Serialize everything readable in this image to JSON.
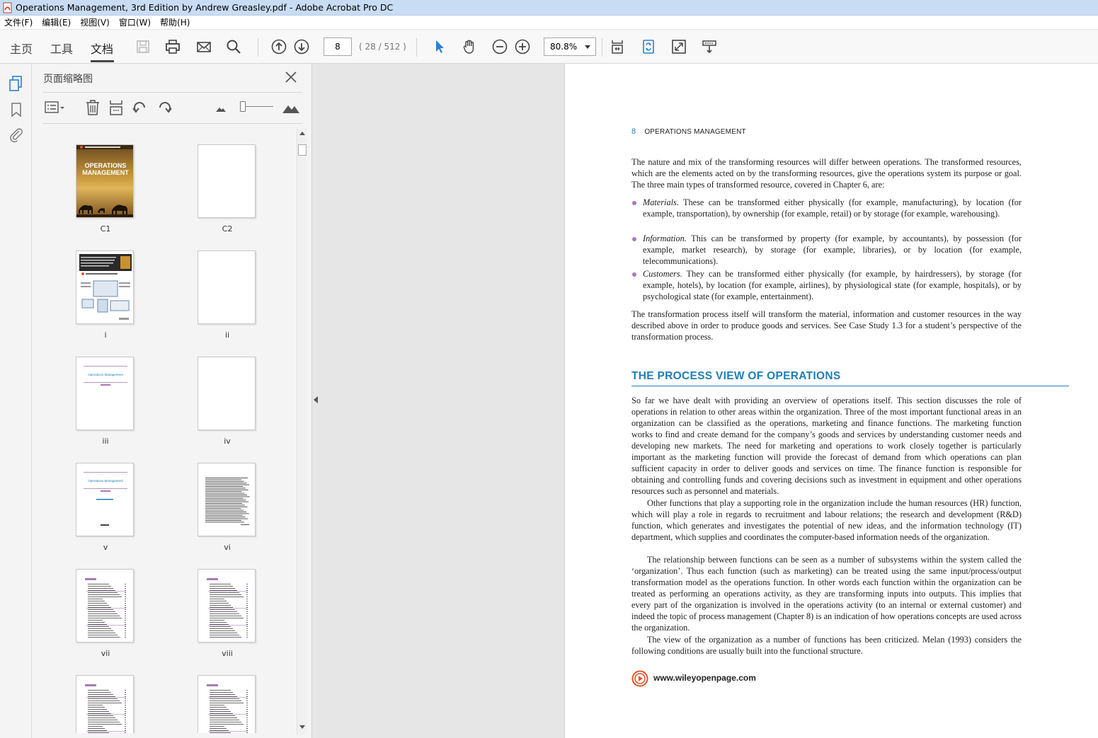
{
  "window": {
    "title": "Operations Management, 3rd Edition by Andrew Greasley.pdf - Adobe Acrobat Pro DC"
  },
  "menu": [
    "文件(F)",
    "编辑(E)",
    "视图(V)",
    "窗口(W)",
    "帮助(H)"
  ],
  "tabs": {
    "home": "主页",
    "tools": "工具",
    "document": "文档"
  },
  "toolbar": {
    "page_number": "8",
    "page_count": "( 28 / 512 )",
    "zoom": "80.8%"
  },
  "panel": {
    "title": "页面缩略图",
    "thumbnails": [
      {
        "label": "C1",
        "kind": "cover",
        "cover_title": "OPERATIONS MANAGEMENT"
      },
      {
        "label": "C2",
        "kind": "blank"
      },
      {
        "label": "i",
        "kind": "ebook"
      },
      {
        "label": "ii",
        "kind": "blank"
      },
      {
        "label": "iii",
        "kind": "halftitle",
        "small_title": "Operations Management"
      },
      {
        "label": "iv",
        "kind": "blank"
      },
      {
        "label": "v",
        "kind": "titlepage",
        "small_title": "Operations Management"
      },
      {
        "label": "vi",
        "kind": "text"
      },
      {
        "label": "vii",
        "kind": "toc"
      },
      {
        "label": "viii",
        "kind": "toc"
      },
      {
        "label": "",
        "kind": "toc"
      },
      {
        "label": "",
        "kind": "toc"
      }
    ]
  },
  "document": {
    "page_number": "8",
    "running_head": "OPERATIONS MANAGEMENT",
    "intro": "The nature and mix of the transforming resources will differ between operations. The transformed resources, which are the elements acted on by the transforming resources, give the operations system its purpose or goal. The three main types of transformed resource, covered in Chapter 6, are:",
    "bullets": [
      {
        "term": "Materials.",
        "text": " These can be transformed either physically (for example, manufacturing), by location (for example, transportation), by ownership (for example, retail) or by storage (for example, warehousing)."
      },
      {
        "term": "Information.",
        "text": " This can be transformed by property (for example, by accountants), by possession (for example, market research), by storage (for example, libraries), or by location (for example, telecommunications)."
      },
      {
        "term": "Customers.",
        "text": " They can be transformed either physically (for example, by hairdressers), by storage (for example, hotels), by location (for example, airlines), by physiological state (for example, hospitals), or by psychological state (for example, entertainment)."
      }
    ],
    "transformation_para": "The transformation process itself will transform the material, information and customer resources in the way described above in order to produce goods and services. See Case Study 1.3 for a student’s perspective of the transformation process.",
    "section_heading": "THE PROCESS VIEW OF OPERATIONS",
    "para1": "So far we have dealt with providing an overview of operations itself. This section discusses the role of operations in relation to other areas within the organization. Three of the most important functional areas in an organization can be classified as the operations, marketing and finance functions. The marketing function works to find and create demand for the company’s goods and services by understanding customer needs and developing new markets. The need for marketing and operations to work closely together is particularly important as the marketing function will provide the forecast of demand from which operations can plan sufficient capacity in order to deliver goods and services on time. The finance function is responsible for obtaining and controlling funds and covering decisions such as investment in equipment and other operations resources such as personnel and materials.",
    "para2": "Other functions that play a supporting role in the organization include the human resources (HR) function, which will play a role in regards to recruitment and labour relations; the research and development (R&D) function, which generates and investigates the potential of new ideas, and the information technology (IT) department, which supplies and coordinates the computer-based information needs of the organization.",
    "para3": "The relationship between functions can be seen as a number of subsystems within the system called the ‘organization’. Thus each function (such as marketing) can be treated using the same input/process/output transformation model as the operations function. In other words each function within the organization can be treated as performing an operations activity, as they are transforming inputs into outputs. This implies that every part of the organization is involved in the operations activity (to an internal or external customer) and indeed the topic of process management (Chapter 8) is an indication of how operations concepts are used across the organization.",
    "para4": "The view of the organization as a number of functions has been criticized. Melan (1993) considers the following conditions are usually built into the functional structure.",
    "website": "www.wileyopenpage.com"
  },
  "colors": {
    "accent": "#1e7fb6",
    "bullet": "#a77ab6",
    "titlebar": "#c8dcf4",
    "select_tool": "#2c7fd2"
  }
}
